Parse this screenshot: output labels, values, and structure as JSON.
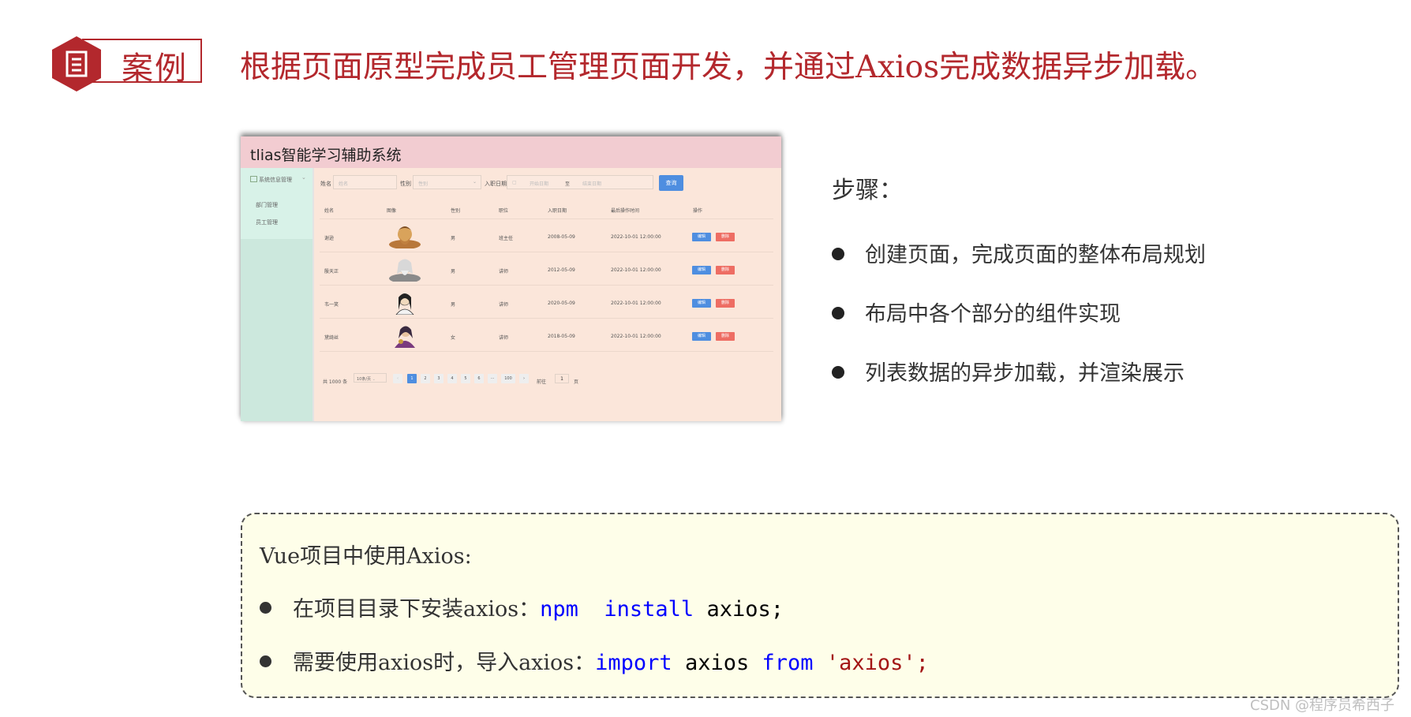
{
  "header": {
    "badge_label": "案例",
    "title": "根据页面原型完成员工管理页面开发，并通过Axios完成数据异步加载。",
    "accent_color": "#b3282d"
  },
  "mock": {
    "app_title": "tlias智能学习辅助系统",
    "sidebar": {
      "group": "系统信息管理",
      "items": [
        "部门管理",
        "员工管理"
      ]
    },
    "filters": {
      "name_label": "姓名",
      "name_placeholder": "姓名",
      "gender_label": "性别",
      "gender_placeholder": "性别",
      "date_label": "入职日期",
      "date_start_placeholder": "开始日期",
      "date_to": "至",
      "date_end_placeholder": "结束日期",
      "query_button": "查询"
    },
    "table": {
      "columns": [
        "姓名",
        "图像",
        "性别",
        "职位",
        "入职日期",
        "最后操作时间",
        "操作"
      ],
      "rows": [
        {
          "name": "谢逊",
          "gender": "男",
          "job": "班主任",
          "entry": "2008-05-09",
          "updated": "2022-10-01 12:00:00",
          "avatar": "xiexun-avatar"
        },
        {
          "name": "殷天正",
          "gender": "男",
          "job": "讲师",
          "entry": "2012-05-09",
          "updated": "2022-10-01 12:00:00",
          "avatar": "yintianzheng-avatar"
        },
        {
          "name": "韦一笑",
          "gender": "男",
          "job": "讲师",
          "entry": "2020-05-09",
          "updated": "2022-10-01 12:00:00",
          "avatar": "weiyixiao-avatar"
        },
        {
          "name": "黛绮丝",
          "gender": "女",
          "job": "讲师",
          "entry": "2018-05-09",
          "updated": "2022-10-01 12:00:00",
          "avatar": "daiqisi-avatar"
        }
      ],
      "edit_label": "编辑",
      "delete_label": "删除"
    },
    "pagination": {
      "total": "共 1000 条",
      "page_size": "10条/页",
      "prev": "‹",
      "pages": [
        "1",
        "2",
        "3",
        "4",
        "5",
        "6",
        "···",
        "100"
      ],
      "next": "›",
      "goto_label": "前往",
      "goto_value": "1",
      "page_suffix": "页"
    }
  },
  "steps": {
    "heading": "步骤：",
    "items": [
      "创建页面，完成页面的整体布局规划",
      "布局中各个部分的组件实现",
      "列表数据的异步加载，并渲染展示"
    ]
  },
  "code_panel": {
    "title": "Vue项目中使用Axios:",
    "line1_prefix": "在项目目录下安装axios：",
    "line1_code_kw1": "npm",
    "line1_code_kw2": "install",
    "line1_code_id": "axios;",
    "line2_prefix": "需要使用axios时，导入axios：",
    "line2_code_kw1": "import",
    "line2_code_id": "axios",
    "line2_code_kw2": "from",
    "line2_code_str": "'axios';"
  },
  "watermark": "CSDN @程序员希西子"
}
